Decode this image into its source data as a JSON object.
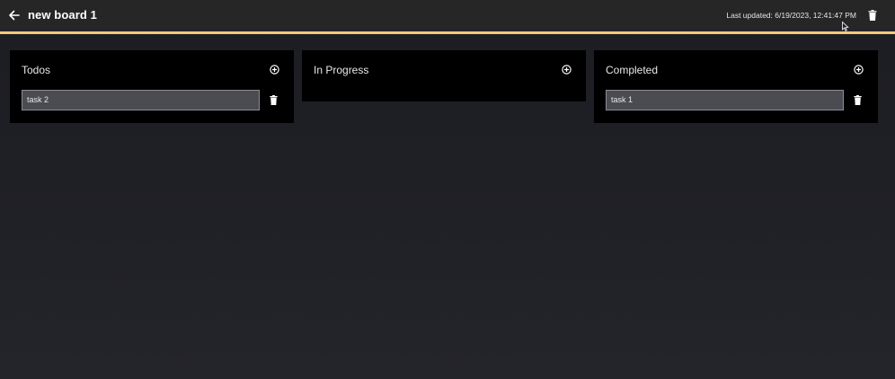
{
  "header": {
    "board_title": "new board 1",
    "last_updated": "Last updated: 6/19/2023, 12:41:47 PM",
    "back_icon": "arrow-left-icon",
    "delete_icon": "trash-icon",
    "accent_color": "#f5c97a",
    "bar_color": "#262626"
  },
  "columns": [
    {
      "title": "Todos",
      "add_icon": "plus-circle-icon",
      "tasks": [
        {
          "text": "task 2",
          "delete_icon": "trash-icon"
        }
      ]
    },
    {
      "title": "In Progress",
      "add_icon": "plus-circle-icon",
      "tasks": []
    },
    {
      "title": "Completed",
      "add_icon": "plus-circle-icon",
      "tasks": [
        {
          "text": "task 1",
          "delete_icon": "trash-icon"
        }
      ]
    }
  ]
}
